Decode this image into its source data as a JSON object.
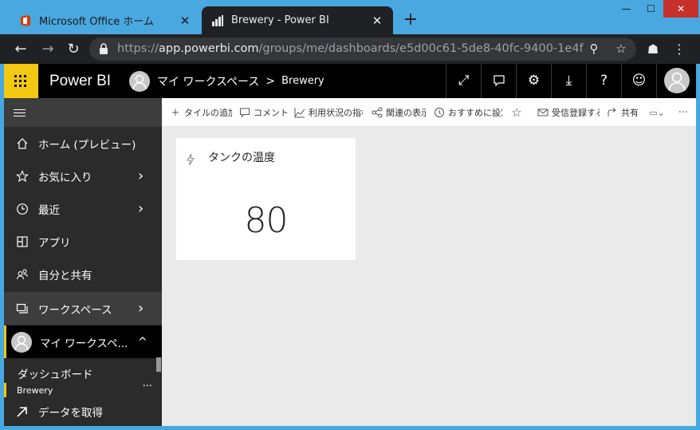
{
  "browser": {
    "tabs": [
      {
        "title": "Microsoft Office ホーム",
        "close": "✕",
        "favicon": "office-icon",
        "active": false
      },
      {
        "title": "Brewery - Power BI",
        "close": "✕",
        "favicon": "powerbi-icon",
        "active": true
      }
    ],
    "new_tab": "+",
    "window_controls": {
      "minimize": "—",
      "maximize": "☐",
      "close": "✕"
    },
    "url": {
      "scheme": "https://",
      "host": "app.powerbi.com",
      "path": "/groups/me/dashboards/e5d00c61-5de8-40fc-9400-1e4f…"
    }
  },
  "header": {
    "brand": "Power BI",
    "breadcrumb": {
      "workspace": "マイ ワークスペース",
      "separator": ">",
      "dashboard": "Brewery"
    },
    "buttons": [
      "expand-icon",
      "comment-icon",
      "settings-icon",
      "download-icon",
      "help-icon",
      "feedback-icon"
    ],
    "button_glyphs": {
      "expand": "⤢",
      "comment": "🗨",
      "settings": "⚙",
      "download": "⤓",
      "help": "?",
      "feedback": "☺"
    }
  },
  "sidebar": {
    "items": [
      {
        "label": "ホーム (プレビュー)",
        "icon": "home-icon",
        "chevron": ""
      },
      {
        "label": "お気に入り",
        "icon": "star-icon",
        "chevron": "›"
      },
      {
        "label": "最近",
        "icon": "clock-icon",
        "chevron": "›"
      },
      {
        "label": "アプリ",
        "icon": "apps-icon",
        "chevron": ""
      },
      {
        "label": "自分と共有",
        "icon": "shared-icon",
        "chevron": ""
      },
      {
        "label": "ワークスペース",
        "icon": "workspaces-icon",
        "chevron": "›"
      },
      {
        "label": "マイ ワークスペ...",
        "icon": "avatar",
        "chevron": "^"
      }
    ],
    "section": "ダッシュボード",
    "dashboard_item": "Brewery",
    "more": "···",
    "get_data": "データを取得"
  },
  "actions": [
    {
      "label": "タイルの追加",
      "icon": "plus-icon",
      "glyph": "+"
    },
    {
      "label": "コメント",
      "icon": "comment-icon",
      "glyph": "🗨"
    },
    {
      "label": "利用状況の指標",
      "icon": "usage-icon",
      "glyph": "⟋"
    },
    {
      "label": "関連の表示",
      "icon": "lineage-icon",
      "glyph": "⋔"
    },
    {
      "label": "おすすめに設定",
      "icon": "featured-icon",
      "glyph": "◎"
    },
    {
      "label": "",
      "icon": "favorite-star-icon",
      "glyph": "☆"
    },
    {
      "label": "受信登録する",
      "icon": "mail-icon",
      "glyph": "✉"
    },
    {
      "label": "共有",
      "icon": "share-icon",
      "glyph": "↗"
    },
    {
      "label": "",
      "icon": "view-icon",
      "glyph": "▭⌄"
    },
    {
      "label": "",
      "icon": "more-icon",
      "glyph": "···"
    }
  ],
  "tile": {
    "title": "タンクの温度",
    "value": "80"
  },
  "colors": {
    "accent": "#f2c811",
    "header_bg": "#000000",
    "sidebar_bg": "#2b2b2b",
    "canvas_bg": "#eaeaea"
  }
}
